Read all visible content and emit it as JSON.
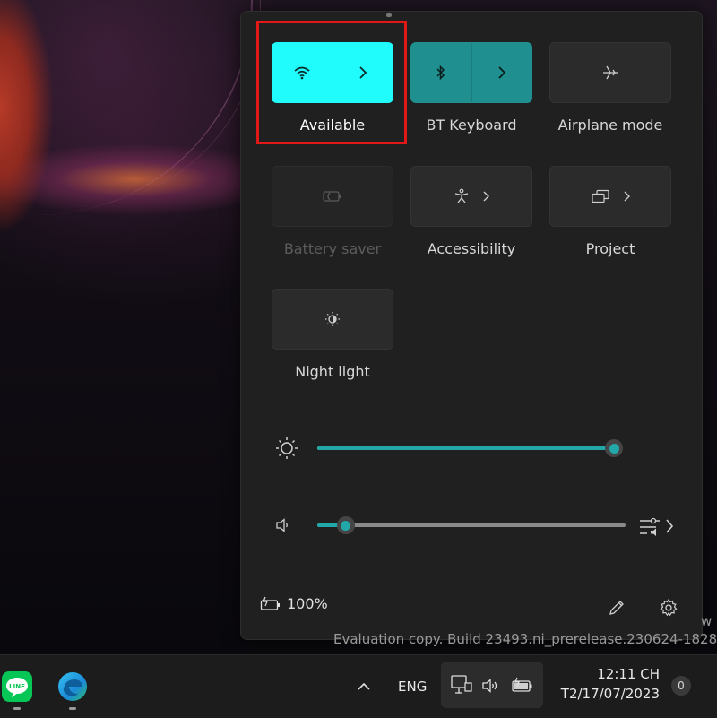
{
  "quick_settings": {
    "tiles": [
      {
        "id": "wifi",
        "label": "Available",
        "icon": "wifi-icon",
        "state": "on",
        "has_expand": true
      },
      {
        "id": "bluetooth",
        "label": "BT Keyboard",
        "icon": "bluetooth-icon",
        "state": "on",
        "has_expand": true
      },
      {
        "id": "airplane",
        "label": "Airplane mode",
        "icon": "airplane-icon",
        "state": "off",
        "has_expand": false
      },
      {
        "id": "battery_saver",
        "label": "Battery saver",
        "icon": "battery-saver-icon",
        "state": "disabled",
        "has_expand": false
      },
      {
        "id": "accessibility",
        "label": "Accessibility",
        "icon": "accessibility-icon",
        "state": "off",
        "has_expand": true
      },
      {
        "id": "project",
        "label": "Project",
        "icon": "project-icon",
        "state": "off",
        "has_expand": true
      },
      {
        "id": "night_light",
        "label": "Night light",
        "icon": "night-light-icon",
        "state": "off",
        "has_expand": false
      }
    ],
    "brightness": {
      "icon": "brightness-icon",
      "level_percent": 100
    },
    "volume": {
      "icon": "speaker-icon",
      "level_percent": 8,
      "extra_icon": "audio-output-icon"
    },
    "battery": {
      "icon": "battery-charging-icon",
      "text": "100%"
    },
    "footer_icons": [
      "edit-pencil-icon",
      "settings-gear-icon"
    ]
  },
  "watermark": {
    "line": "Evaluation copy. Build 23493.ni_prerelease.230624-1828",
    "overflow_char": "w"
  },
  "taskbar": {
    "apps": [
      {
        "name": "LINE",
        "icon": "line-app-icon",
        "label": "LINE"
      },
      {
        "name": "Microsoft Edge",
        "icon": "edge-browser-icon"
      }
    ],
    "tray": {
      "overflow_icon": "chevron-up-icon",
      "language": "ENG",
      "status_icons": [
        "network-icon",
        "volume-icon",
        "battery-icon"
      ],
      "time": "12:11 CH",
      "date": "T2/17/07/2023",
      "notifications": "0"
    }
  },
  "colors": {
    "wifi_on": "#20fbfb",
    "bt_on": "#1f8f8f",
    "slider_fill": "#22a8a8",
    "highlight": "#e01818",
    "panel_bg": "#202020"
  }
}
